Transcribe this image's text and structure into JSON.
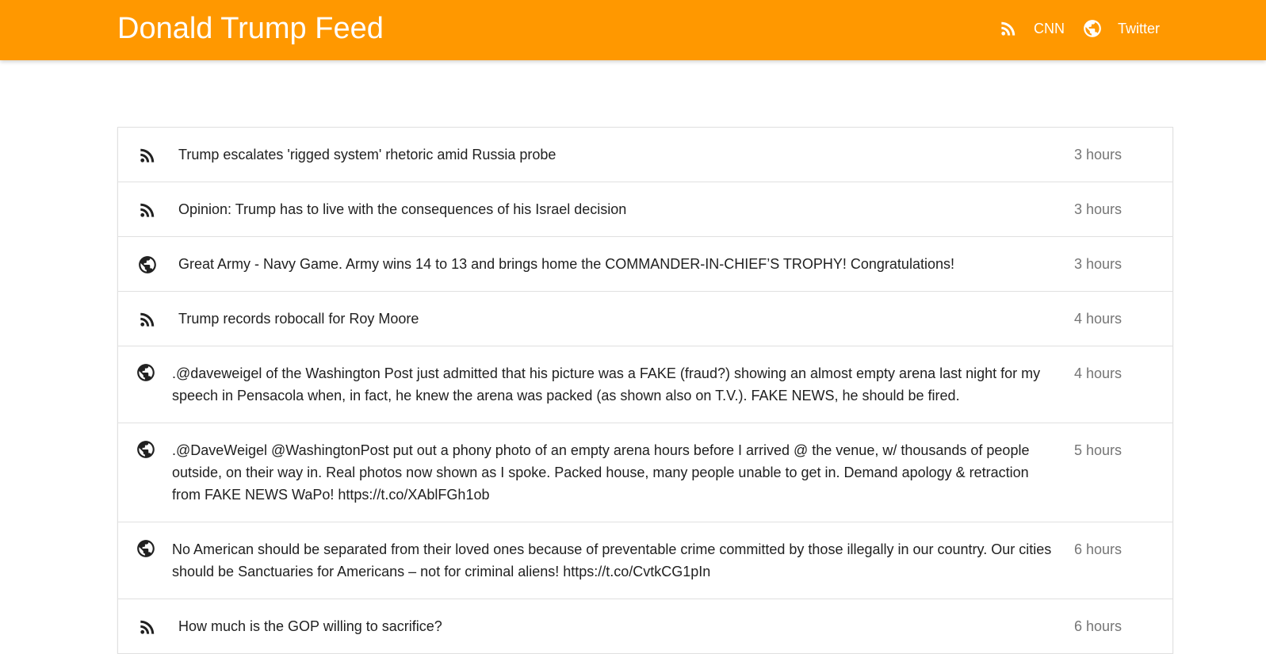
{
  "app": {
    "title": "Donald Trump Feed",
    "accent_color": "#ff9800"
  },
  "nav": {
    "links": [
      {
        "label": "CNN",
        "icon": "rss-icon"
      },
      {
        "label": "Twitter",
        "icon": "globe-icon"
      }
    ]
  },
  "feed": {
    "items": [
      {
        "source": "rss",
        "icon": "rss-icon",
        "text": "Trump escalates 'rigged system' rhetoric amid Russia probe",
        "time": "3 hours"
      },
      {
        "source": "rss",
        "icon": "rss-icon",
        "text": "Opinion: Trump has to live with the consequences of his Israel decision",
        "time": "3 hours"
      },
      {
        "source": "twitter",
        "icon": "globe-icon",
        "text": "Great Army - Navy Game. Army wins 14 to 13 and brings home the COMMANDER-IN-CHIEF’S TROPHY! Congratulations!",
        "time": "3 hours"
      },
      {
        "source": "rss",
        "icon": "rss-icon",
        "text": "Trump records robocall for Roy Moore",
        "time": "4 hours"
      },
      {
        "source": "twitter",
        "icon": "globe-icon",
        "text": ".@daveweigel of the Washington Post just admitted that his picture was a FAKE (fraud?) showing an almost empty arena last night for my speech in Pensacola when, in fact, he knew the arena was packed (as shown also on T.V.). FAKE NEWS, he should be fired.",
        "time": "4 hours"
      },
      {
        "source": "twitter",
        "icon": "globe-icon",
        "text": ".@DaveWeigel @WashingtonPost put out a phony photo of an empty arena hours before I arrived @ the venue, w/ thousands of people outside, on their way in. Real photos now shown as I spoke. Packed house, many people unable to get in. Demand apology & retraction from FAKE NEWS WaPo! https://t.co/XAblFGh1ob",
        "time": "5 hours"
      },
      {
        "source": "twitter",
        "icon": "globe-icon",
        "text": "No American should be separated from their loved ones because of preventable crime committed by those illegally in our country. Our cities should be Sanctuaries for Americans – not for criminal aliens! https://t.co/CvtkCG1pIn",
        "time": "6 hours"
      },
      {
        "source": "rss",
        "icon": "rss-icon",
        "text": "How much is the GOP willing to sacrifice?",
        "time": "6 hours"
      }
    ]
  }
}
